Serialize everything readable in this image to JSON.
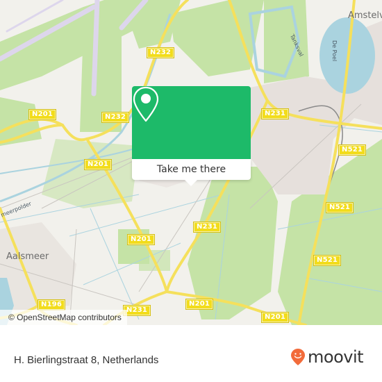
{
  "map": {
    "colors": {
      "land": "#f2f1ec",
      "green": "#c5e3a6",
      "water": "#aad3df",
      "road": "#f5e05c",
      "urban": "#e6e0dc",
      "runway": "#ddd6ec"
    },
    "road_labels": [
      {
        "id": "n232-top",
        "text": "N232"
      },
      {
        "id": "n232-mid",
        "text": "N232"
      },
      {
        "id": "n201-west",
        "text": "N201"
      },
      {
        "id": "n201-center",
        "text": "N201"
      },
      {
        "id": "n201-south",
        "text": "N201"
      },
      {
        "id": "n201-bottom",
        "text": "N201"
      },
      {
        "id": "n201-lower",
        "text": "N201"
      },
      {
        "id": "n231-north",
        "text": "N231"
      },
      {
        "id": "n231-mid",
        "text": "N231"
      },
      {
        "id": "n231-south",
        "text": "N231"
      },
      {
        "id": "n521-north",
        "text": "N521"
      },
      {
        "id": "n521-mid",
        "text": "N521"
      },
      {
        "id": "n521-south",
        "text": "N521"
      },
      {
        "id": "n196",
        "text": "N196"
      }
    ],
    "place_labels": {
      "aalsmeer": "Aalsmeer",
      "amstelveen": "Amstelv"
    },
    "water_labels": {
      "de_poel": "De Poel",
      "tanksval": "Tanksval",
      "meerpolder": "meerpolder"
    },
    "attribution": "© OpenStreetMap contributors"
  },
  "popup": {
    "icon": "location-pin-icon",
    "button_label": "Take me there",
    "color": "#1dba69"
  },
  "footer": {
    "address": "H. Bierlingstraat 8, Netherlands",
    "brand": "moovit",
    "brand_color": "#f26b3a"
  }
}
